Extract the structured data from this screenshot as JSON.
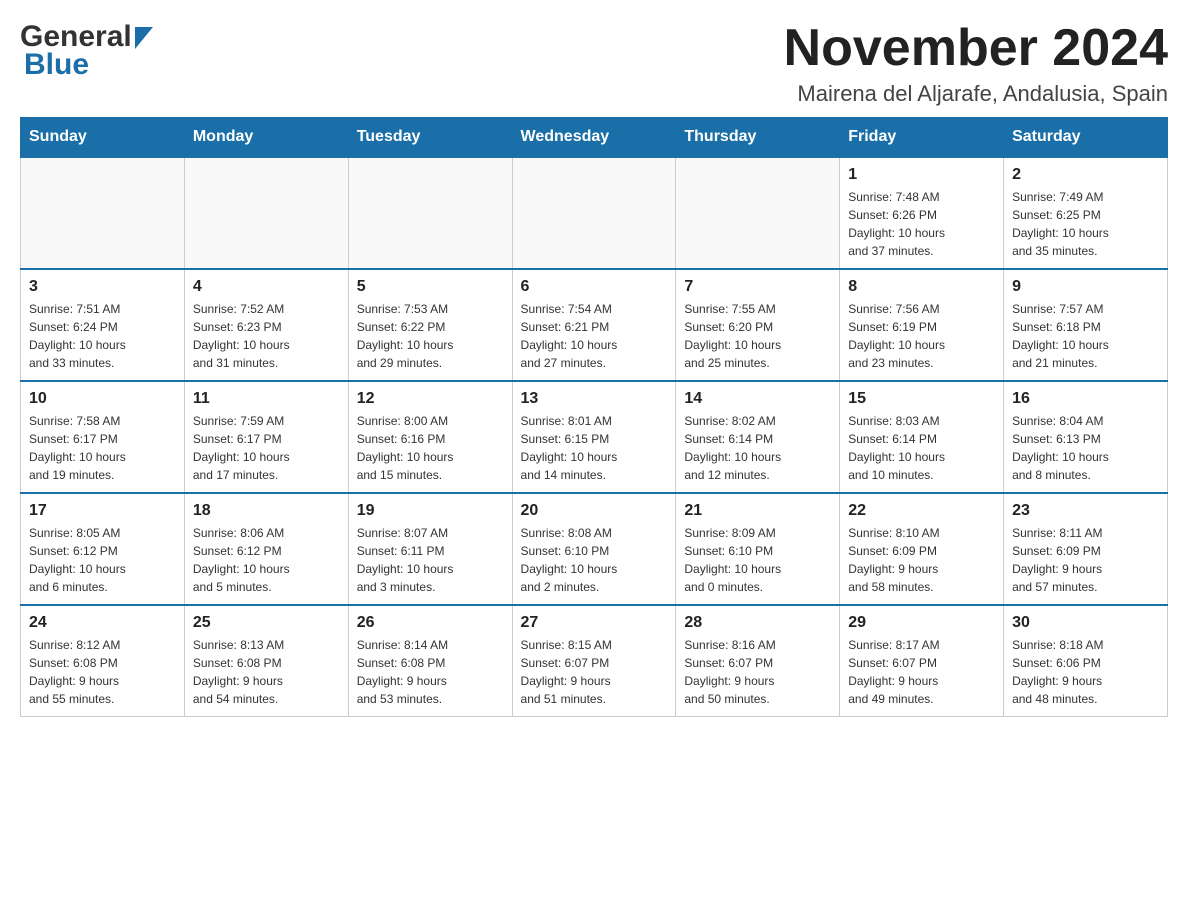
{
  "header": {
    "title": "November 2024",
    "location": "Mairena del Aljarafe, Andalusia, Spain",
    "logo_general": "General",
    "logo_blue": "Blue"
  },
  "weekdays": [
    "Sunday",
    "Monday",
    "Tuesday",
    "Wednesday",
    "Thursday",
    "Friday",
    "Saturday"
  ],
  "weeks": [
    [
      {
        "day": "",
        "info": ""
      },
      {
        "day": "",
        "info": ""
      },
      {
        "day": "",
        "info": ""
      },
      {
        "day": "",
        "info": ""
      },
      {
        "day": "",
        "info": ""
      },
      {
        "day": "1",
        "info": "Sunrise: 7:48 AM\nSunset: 6:26 PM\nDaylight: 10 hours\nand 37 minutes."
      },
      {
        "day": "2",
        "info": "Sunrise: 7:49 AM\nSunset: 6:25 PM\nDaylight: 10 hours\nand 35 minutes."
      }
    ],
    [
      {
        "day": "3",
        "info": "Sunrise: 7:51 AM\nSunset: 6:24 PM\nDaylight: 10 hours\nand 33 minutes."
      },
      {
        "day": "4",
        "info": "Sunrise: 7:52 AM\nSunset: 6:23 PM\nDaylight: 10 hours\nand 31 minutes."
      },
      {
        "day": "5",
        "info": "Sunrise: 7:53 AM\nSunset: 6:22 PM\nDaylight: 10 hours\nand 29 minutes."
      },
      {
        "day": "6",
        "info": "Sunrise: 7:54 AM\nSunset: 6:21 PM\nDaylight: 10 hours\nand 27 minutes."
      },
      {
        "day": "7",
        "info": "Sunrise: 7:55 AM\nSunset: 6:20 PM\nDaylight: 10 hours\nand 25 minutes."
      },
      {
        "day": "8",
        "info": "Sunrise: 7:56 AM\nSunset: 6:19 PM\nDaylight: 10 hours\nand 23 minutes."
      },
      {
        "day": "9",
        "info": "Sunrise: 7:57 AM\nSunset: 6:18 PM\nDaylight: 10 hours\nand 21 minutes."
      }
    ],
    [
      {
        "day": "10",
        "info": "Sunrise: 7:58 AM\nSunset: 6:17 PM\nDaylight: 10 hours\nand 19 minutes."
      },
      {
        "day": "11",
        "info": "Sunrise: 7:59 AM\nSunset: 6:17 PM\nDaylight: 10 hours\nand 17 minutes."
      },
      {
        "day": "12",
        "info": "Sunrise: 8:00 AM\nSunset: 6:16 PM\nDaylight: 10 hours\nand 15 minutes."
      },
      {
        "day": "13",
        "info": "Sunrise: 8:01 AM\nSunset: 6:15 PM\nDaylight: 10 hours\nand 14 minutes."
      },
      {
        "day": "14",
        "info": "Sunrise: 8:02 AM\nSunset: 6:14 PM\nDaylight: 10 hours\nand 12 minutes."
      },
      {
        "day": "15",
        "info": "Sunrise: 8:03 AM\nSunset: 6:14 PM\nDaylight: 10 hours\nand 10 minutes."
      },
      {
        "day": "16",
        "info": "Sunrise: 8:04 AM\nSunset: 6:13 PM\nDaylight: 10 hours\nand 8 minutes."
      }
    ],
    [
      {
        "day": "17",
        "info": "Sunrise: 8:05 AM\nSunset: 6:12 PM\nDaylight: 10 hours\nand 6 minutes."
      },
      {
        "day": "18",
        "info": "Sunrise: 8:06 AM\nSunset: 6:12 PM\nDaylight: 10 hours\nand 5 minutes."
      },
      {
        "day": "19",
        "info": "Sunrise: 8:07 AM\nSunset: 6:11 PM\nDaylight: 10 hours\nand 3 minutes."
      },
      {
        "day": "20",
        "info": "Sunrise: 8:08 AM\nSunset: 6:10 PM\nDaylight: 10 hours\nand 2 minutes."
      },
      {
        "day": "21",
        "info": "Sunrise: 8:09 AM\nSunset: 6:10 PM\nDaylight: 10 hours\nand 0 minutes."
      },
      {
        "day": "22",
        "info": "Sunrise: 8:10 AM\nSunset: 6:09 PM\nDaylight: 9 hours\nand 58 minutes."
      },
      {
        "day": "23",
        "info": "Sunrise: 8:11 AM\nSunset: 6:09 PM\nDaylight: 9 hours\nand 57 minutes."
      }
    ],
    [
      {
        "day": "24",
        "info": "Sunrise: 8:12 AM\nSunset: 6:08 PM\nDaylight: 9 hours\nand 55 minutes."
      },
      {
        "day": "25",
        "info": "Sunrise: 8:13 AM\nSunset: 6:08 PM\nDaylight: 9 hours\nand 54 minutes."
      },
      {
        "day": "26",
        "info": "Sunrise: 8:14 AM\nSunset: 6:08 PM\nDaylight: 9 hours\nand 53 minutes."
      },
      {
        "day": "27",
        "info": "Sunrise: 8:15 AM\nSunset: 6:07 PM\nDaylight: 9 hours\nand 51 minutes."
      },
      {
        "day": "28",
        "info": "Sunrise: 8:16 AM\nSunset: 6:07 PM\nDaylight: 9 hours\nand 50 minutes."
      },
      {
        "day": "29",
        "info": "Sunrise: 8:17 AM\nSunset: 6:07 PM\nDaylight: 9 hours\nand 49 minutes."
      },
      {
        "day": "30",
        "info": "Sunrise: 8:18 AM\nSunset: 6:06 PM\nDaylight: 9 hours\nand 48 minutes."
      }
    ]
  ]
}
